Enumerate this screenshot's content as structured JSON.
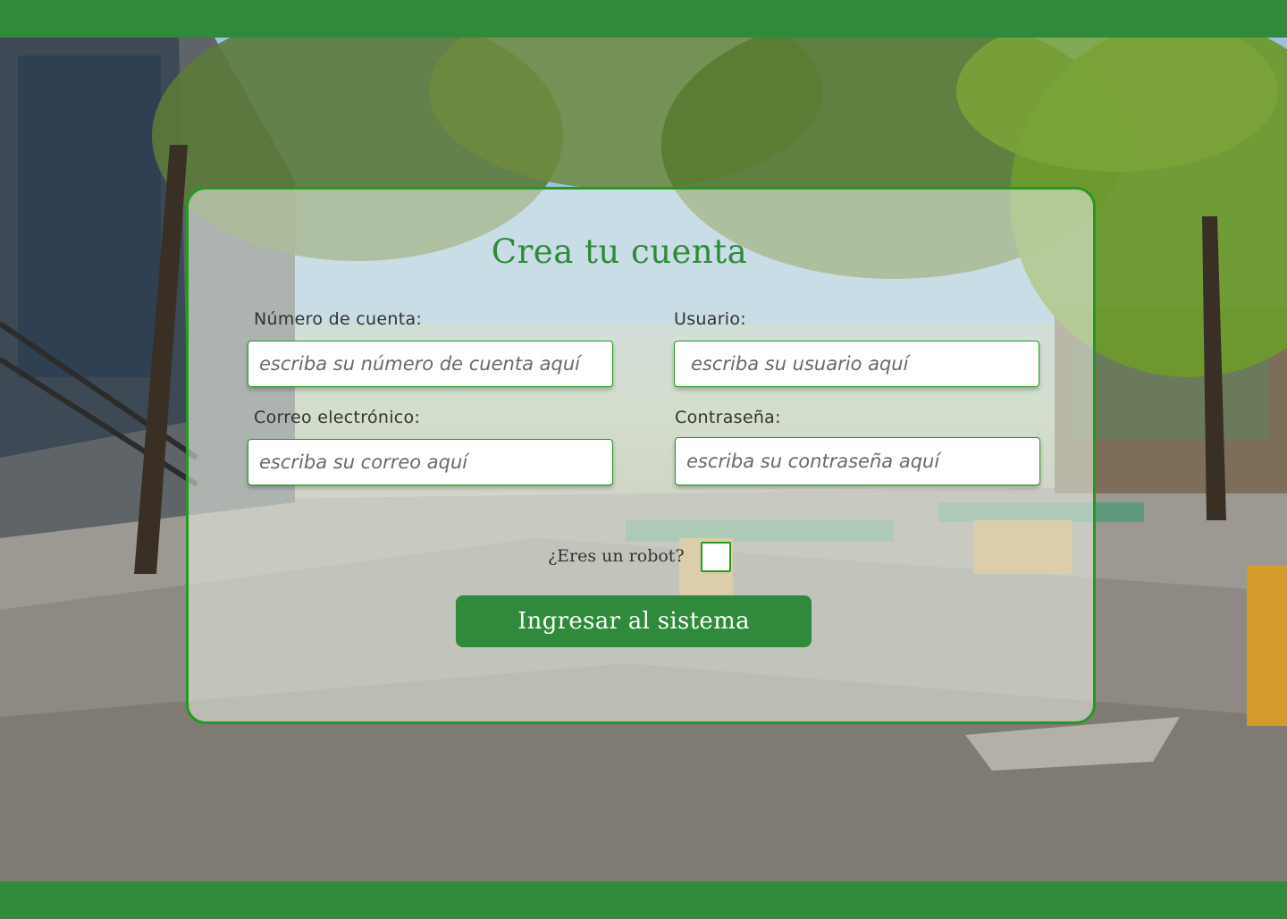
{
  "form": {
    "title": "Crea tu cuenta",
    "fields": {
      "account_number": {
        "label": "Número de cuenta:",
        "placeholder": "escriba su número de cuenta aquí",
        "value": ""
      },
      "username": {
        "label": "Usuario:",
        "placeholder": "escriba su usuario aquí",
        "value": ""
      },
      "email": {
        "label": "Correo electrónico:",
        "placeholder": "escriba su correo aquí",
        "value": ""
      },
      "password": {
        "label": "Contraseña:",
        "placeholder": "escriba su contraseña aquí",
        "value": ""
      }
    },
    "captcha": {
      "label": "¿Eres un robot?",
      "checked": false
    },
    "submit_label": "Ingresar al sistema"
  },
  "colors": {
    "brand_green": "#2f8a3b",
    "border_green": "#249a1e"
  }
}
